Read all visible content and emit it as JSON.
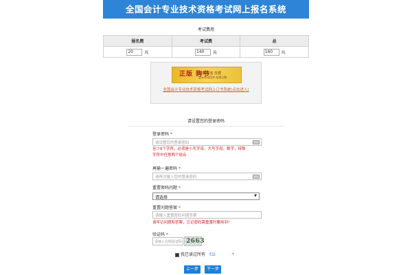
{
  "header": {
    "title": "全国会计专业技术资格考试网上报名系统"
  },
  "fees": {
    "title": "考试费用",
    "columns": [
      "报名费",
      "考试费",
      "总"
    ],
    "values": [
      "20",
      "140",
      "160"
    ],
    "unit": "元"
  },
  "book": {
    "banner_big": "正版 购书",
    "banner_small": "登录·报名·交费",
    "banner_small2": "会计考试用书 在线订购",
    "link": "全国会计专业技术资格考试网上订书系统(点击进入)"
  },
  "form": {
    "title": "请设置您的登录密码",
    "password": {
      "label": "登录密码",
      "placeholder": "请设置您的登录密码",
      "hint_line1": "至少8个字符，必须是小写字母，大写字母，数字，特殊",
      "hint_line2": "字符中任意两个组合"
    },
    "confirm": {
      "label": "再输一遍密码",
      "placeholder": "请再次输入您的登录密码"
    },
    "question": {
      "label": "重置密码问题",
      "selected": "请选择"
    },
    "answer": {
      "label": "重置问题答案",
      "placeholder": "请输入重置密码问题答案",
      "hint": "请牢记问题和答案，忘记密码需重置时要用到！"
    },
    "captcha": {
      "label": "验证码",
      "placeholder": "请输入右侧验证码",
      "code": "2663"
    },
    "required_mark": "*",
    "agree": {
      "text": "我已读过所有",
      "link": "《公",
      "mark": "*"
    },
    "buttons": {
      "prev": "上一步",
      "next": "下一步"
    }
  },
  "colors": {
    "header": "#2e84d6",
    "error": "#d62222",
    "button": "#1f7fd8",
    "link": "#d0601c"
  },
  "icons": {
    "keyboard": "keyboard-icon",
    "dropdown": "chevron-down-icon"
  }
}
